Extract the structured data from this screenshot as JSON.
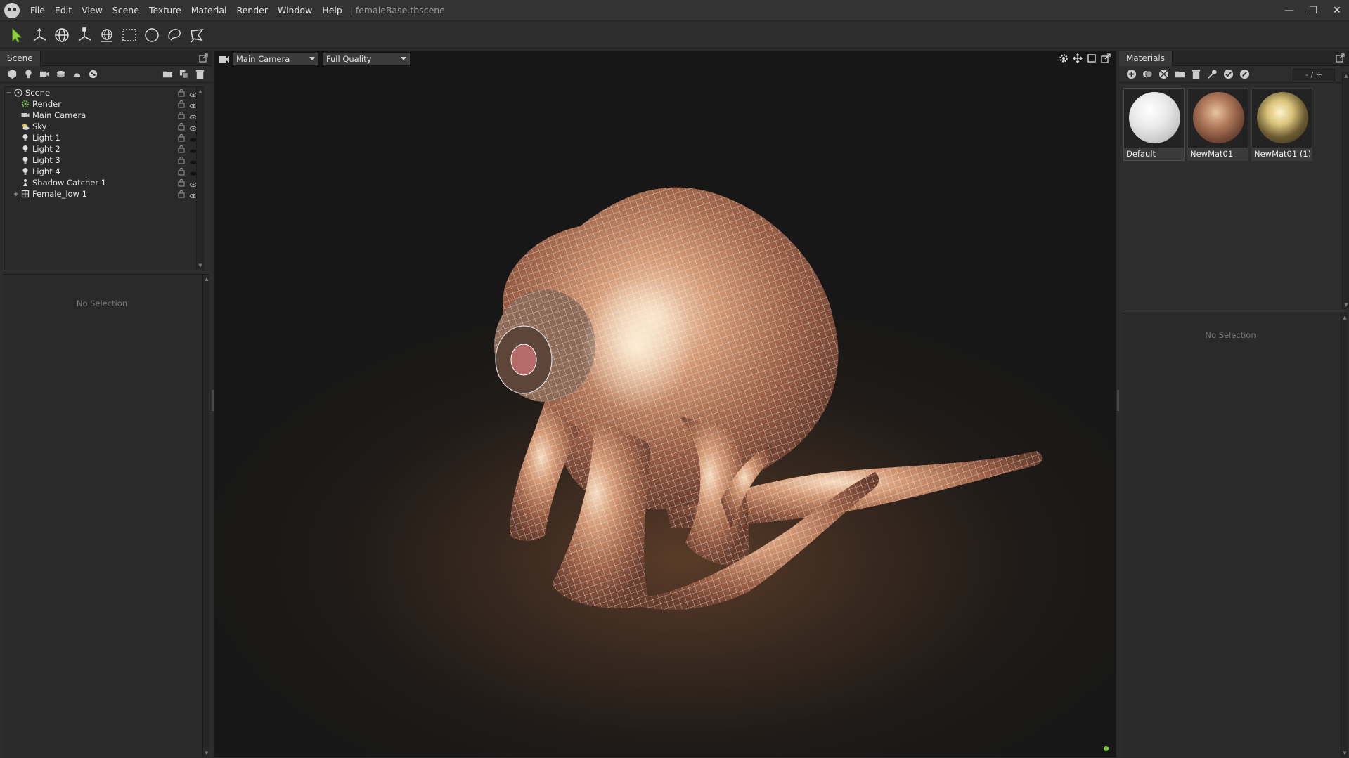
{
  "titlebar": {
    "menu": [
      "File",
      "Edit",
      "View",
      "Scene",
      "Texture",
      "Material",
      "Render",
      "Window",
      "Help"
    ],
    "separator": "|",
    "document_title": "femaleBase.tbscene",
    "controls": {
      "minimize": "—",
      "maximize": "☐",
      "close": "✕"
    }
  },
  "toolbar": {
    "tools": [
      "select-tool-icon",
      "move-tool-icon",
      "rotate-tool-icon",
      "scale-tool-icon",
      "paint-tool-icon",
      "rect-select-icon",
      "circle-select-icon",
      "lasso-select-icon",
      "polygon-select-icon"
    ],
    "active_color": "#8dd43a"
  },
  "scene_panel": {
    "tab": "Scene",
    "tree": [
      {
        "label": "Scene",
        "icon": "scene-root-icon",
        "expander": "−",
        "level": 0,
        "visible": true
      },
      {
        "label": "Render",
        "icon": "render-gear-icon",
        "expander": "",
        "level": 1,
        "visible": true
      },
      {
        "label": "Main Camera",
        "icon": "camera-icon",
        "expander": "",
        "level": 1,
        "visible": true
      },
      {
        "label": "Sky",
        "icon": "sky-icon",
        "expander": "",
        "level": 1,
        "visible": true
      },
      {
        "label": "Light 1",
        "icon": "light-bulb-icon",
        "expander": "",
        "level": 1,
        "visible": false
      },
      {
        "label": "Light 2",
        "icon": "light-bulb-icon",
        "expander": "",
        "level": 1,
        "visible": false
      },
      {
        "label": "Light 3",
        "icon": "light-bulb-icon",
        "expander": "",
        "level": 1,
        "visible": false
      },
      {
        "label": "Light 4",
        "icon": "light-bulb-icon",
        "expander": "",
        "level": 1,
        "visible": false
      },
      {
        "label": "Shadow Catcher 1",
        "icon": "shadow-catcher-icon",
        "expander": "",
        "level": 1,
        "visible": true
      },
      {
        "label": "Female_low 1",
        "icon": "mesh-icon",
        "expander": "+",
        "level": 1,
        "visible": true
      }
    ],
    "properties_empty": "No Selection"
  },
  "viewport": {
    "camera": "Main Camera",
    "quality": "Full Quality",
    "status_color": "#7ec83a"
  },
  "materials_panel": {
    "tab": "Materials",
    "zoom_field": "- / +",
    "materials": [
      {
        "name": "Default",
        "swatch": "default-white"
      },
      {
        "name": "NewMat01",
        "swatch": "brown-skin"
      },
      {
        "name": "NewMat01 (1)",
        "swatch": "yellow-skin"
      }
    ],
    "properties_empty": "No Selection"
  }
}
